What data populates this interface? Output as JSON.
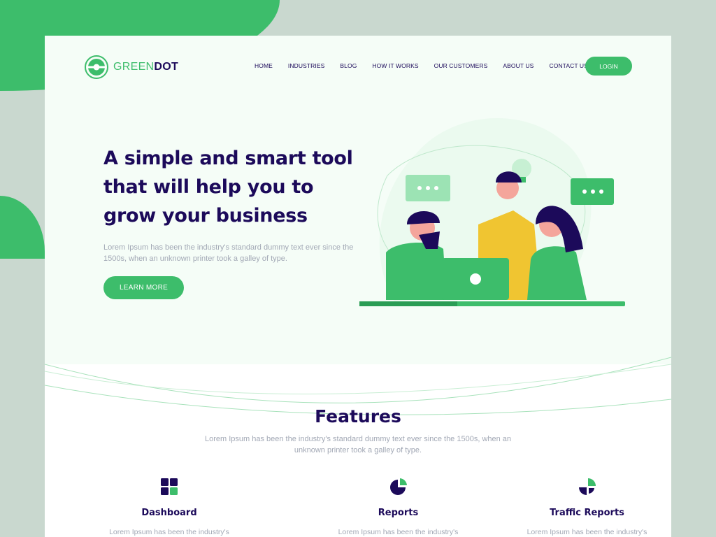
{
  "brand": {
    "name_light": "GREEN",
    "name_bold": "DOT"
  },
  "nav": {
    "items": [
      "HOME",
      "INDUSTRIES",
      "BLOG",
      "HOW IT WORKS",
      "OUR CUSTOMERS",
      "ABOUT US",
      "CONTACT US"
    ],
    "login": "LOGIN"
  },
  "hero": {
    "title": "A simple and smart tool that will help you to grow your business",
    "text": "Lorem Ipsum has been the industry's standard dummy text ever since the 1500s, when an unknown printer took a galley of type.",
    "cta": "LEARN MORE"
  },
  "features": {
    "title": "Features",
    "text": "Lorem Ipsum has been the industry's standard dummy text ever since the 1500s, when an unknown printer took a galley of type.",
    "cards": [
      {
        "icon": "dashboard-icon",
        "title": "Dashboard",
        "text": "Lorem Ipsum has been the industry's"
      },
      {
        "icon": "pie-chart-icon",
        "title": "Reports",
        "text": "Lorem Ipsum has been the industry's"
      },
      {
        "icon": "traffic-chart-icon",
        "title": "Traffic Reports",
        "text": "Lorem Ipsum has been the industry's"
      }
    ]
  },
  "colors": {
    "green": "#3dbd6b",
    "navy": "#1c0a5a",
    "backdrop": "#c9d8cf"
  }
}
